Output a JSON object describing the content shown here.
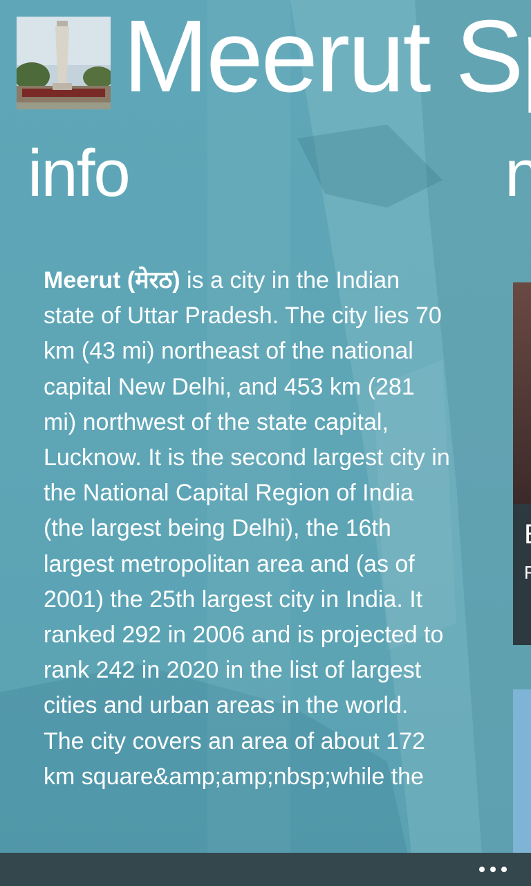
{
  "app": {
    "title": "Meerut Sp"
  },
  "pivot": {
    "current": "info",
    "next_peek": "n"
  },
  "article": {
    "bold_lead": "Meerut (मेरठ)",
    "body": " is a city in the Indian state of Uttar Pradesh. The city lies 70 km (43 mi) northeast of the national capital New Delhi, and 453 km (281 mi) northwest of the state capital, Lucknow. It is the second largest city in the National Capital Region of India (the largest being Delhi), the 16th largest metropolitan area and (as of 2001) the 25th largest city in India. It ranked 292 in 2006 and is projected to rank 242 in 2020 in the list of largest cities and urban areas in the world. The city covers an area of about 172 km square&amp;amp;nbsp;while the"
  },
  "side_card": {
    "title_peek": "E",
    "subtitle_peek": "F"
  },
  "icons": {
    "more": "ellipsis-icon"
  },
  "colors": {
    "background": "#5fa7b8",
    "app_bar": "#34474c",
    "text": "#ffffff"
  }
}
